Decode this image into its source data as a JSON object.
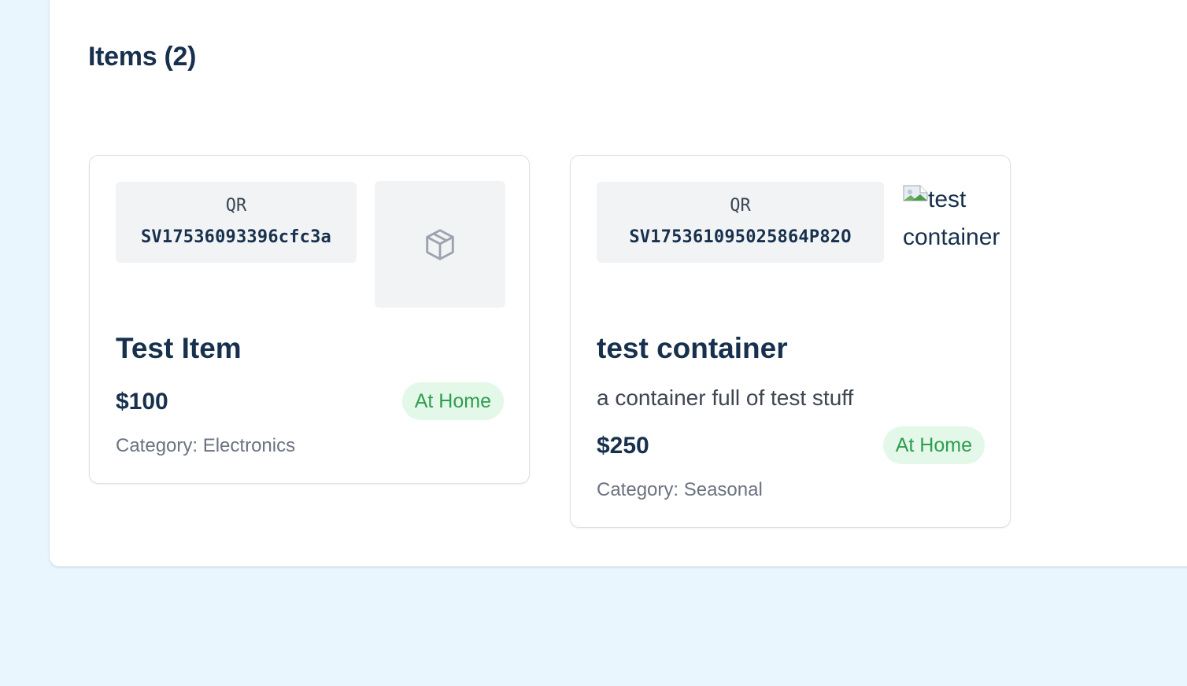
{
  "items_section": {
    "title": "Items (2)"
  },
  "items": [
    {
      "qr_label": "QR",
      "qr_code": "SV17536093396cfc3a",
      "thumbnail_icon": "package-icon",
      "name": "Test Item",
      "description": "",
      "price": "$100",
      "status": "At Home",
      "category": "Category: Electronics"
    },
    {
      "qr_label": "QR",
      "qr_code": "SV175361095025864P82O",
      "thumbnail_alt": "test container",
      "thumbnail_alt_line1": "test",
      "thumbnail_alt_line2": "container",
      "name": "test container",
      "description": "a container full of test stuff",
      "price": "$250",
      "status": "At Home",
      "category": "Category: Seasonal"
    }
  ],
  "colors": {
    "page_background": "#eaf6fd",
    "panel_background": "#ffffff",
    "heading_text": "#17304d",
    "status_badge_background": "#e3f8e8",
    "status_badge_text": "#2f9d4e",
    "muted_text": "#6b7280"
  }
}
